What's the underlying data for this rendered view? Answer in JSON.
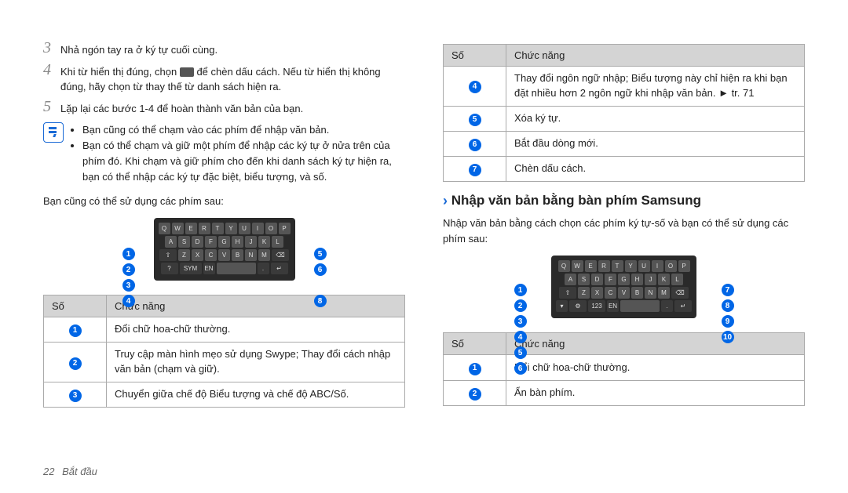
{
  "left": {
    "step3": "Nhả ngón tay ra ở ký tự cuối cùng.",
    "step4a": "Khi từ hiển thị đúng, chọn ",
    "step4b": " để chèn dấu cách. Nếu từ hiển thị không đúng, hãy chọn từ thay thế từ danh sách hiện ra.",
    "step5": "Lặp lại các bước 1-4 để hoàn thành văn bản của bạn.",
    "note1": "Bạn cũng có thể chạm vào các phím để nhập văn bản.",
    "note2": "Bạn có thể chạm và giữ một phím để nhập các ký tự ở nửa trên của phím đó. Khi chạm và giữ phím cho đến khi danh sách ký tự hiện ra, bạn có thể nhập các ký tự đặc biệt, biểu tượng, và số.",
    "after_kbd_text": "Bạn cũng có thể sử dụng các phím sau:",
    "th_num": "Số",
    "th_func": "Chức năng",
    "rows": [
      "Đổi chữ hoa-chữ thường.",
      "Truy cập màn hình mẹo sử dụng Swype; Thay đổi cách nhập văn bản (chạm và giữ).",
      "Chuyển giữa chế độ Biểu tượng và chế độ ABC/Số."
    ]
  },
  "right": {
    "th_num": "Số",
    "th_func": "Chức năng",
    "rows_top": [
      "Thay đổi ngôn ngữ nhập; Biểu tượng này chỉ hiện ra khi bạn đặt nhiều hơn 2 ngôn ngữ khi nhập văn bản. ► tr. 71",
      "Xóa ký tự.",
      "Bắt đầu dòng mới.",
      "Chèn dấu cách."
    ],
    "h2": "Nhập văn bản bằng bàn phím Samsung",
    "intro": "Nhập văn bản bằng cách chọn các phím ký tự-số và bạn có thể sử dụng các phím sau:",
    "rows_bottom": [
      "Đổi chữ hoa-chữ thường.",
      "Ẩn bàn phím."
    ]
  },
  "footer": {
    "page": "22",
    "section": "Bắt đầu"
  }
}
